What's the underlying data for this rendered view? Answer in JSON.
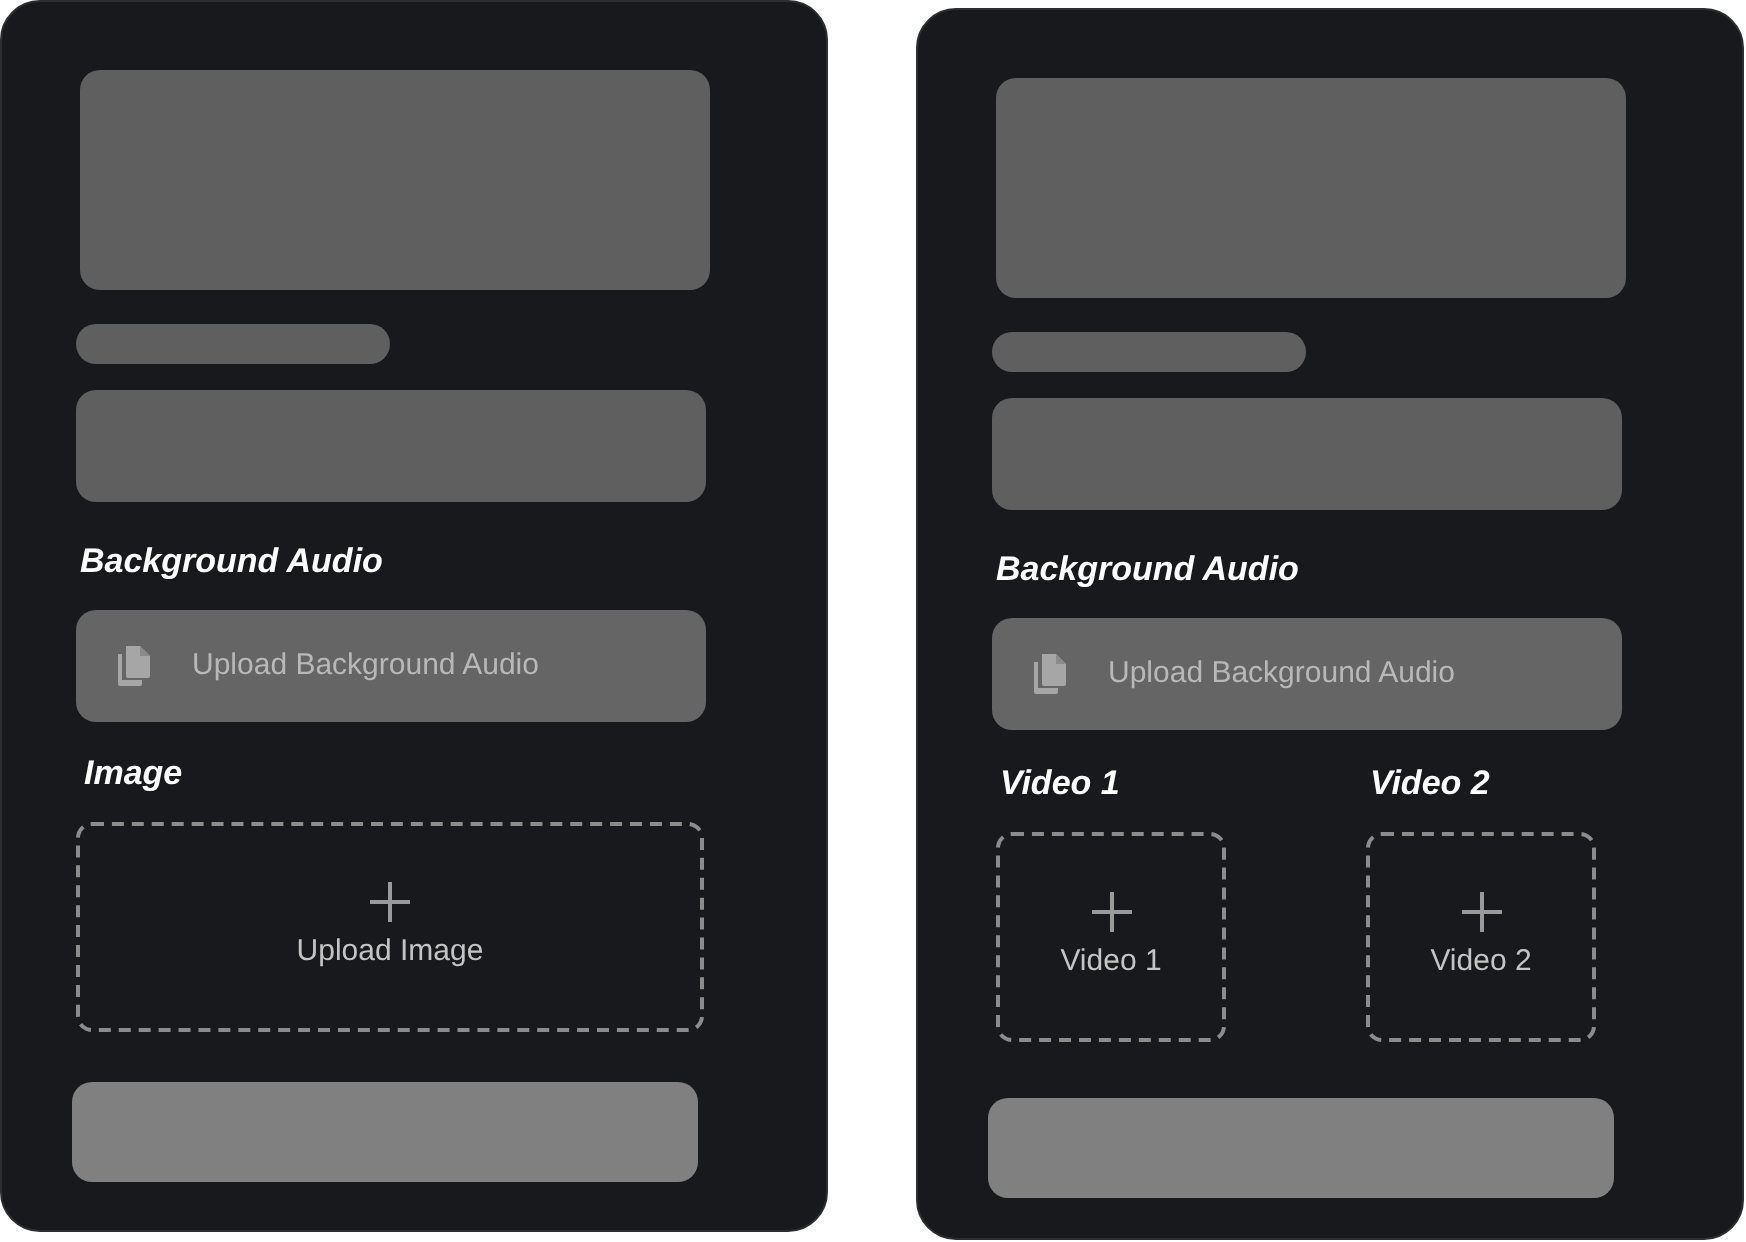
{
  "panels": [
    {
      "audio": {
        "label": "Background Audio",
        "button": "Upload Background Audio"
      },
      "uploads": [
        {
          "label": "Image",
          "button": "Upload Image"
        }
      ]
    },
    {
      "audio": {
        "label": "Background Audio",
        "button": "Upload Background Audio"
      },
      "uploads": [
        {
          "label": "Video 1",
          "button": "Video 1"
        },
        {
          "label": "Video 2",
          "button": "Video 2"
        }
      ]
    }
  ]
}
